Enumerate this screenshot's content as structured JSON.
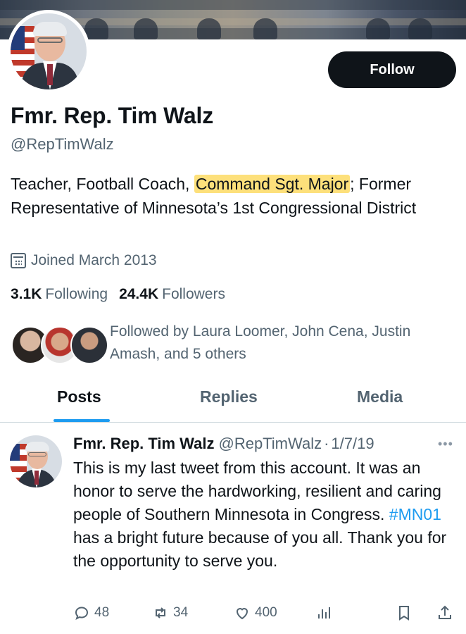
{
  "profile": {
    "follow_label": "Follow",
    "name": "Fmr. Rep. Tim Walz",
    "handle": "@RepTimWalz",
    "bio": {
      "before": "Teacher, Football Coach, ",
      "highlight": "Command Sgt. Major",
      "after": "; Former Representative of Minnesota’s 1st Congressional District"
    },
    "joined": "Joined March 2013",
    "following_count": "3.1K",
    "following_label": "Following",
    "followers_count": "24.4K",
    "followers_label": "Followers",
    "followed_by": "Followed by Laura Loomer, John Cena, Justin Amash, and 5 others"
  },
  "tabs": [
    {
      "label": "Posts",
      "active": true
    },
    {
      "label": "Replies",
      "active": false
    },
    {
      "label": "Media",
      "active": false
    }
  ],
  "tweet": {
    "name": "Fmr. Rep. Tim Walz",
    "handle": "@RepTimWalz",
    "dot": "·",
    "date": "1/7/19",
    "more_icon": "•••",
    "text_before": "This is my last tweet from this account. It was an honor to serve the hardworking, resilient and caring people of Southern Minnesota in Congress. ",
    "hashtag": "#MN01",
    "text_after": " has a bright future because of you all. Thank you for the opportunity to serve you.",
    "replies": "48",
    "retweets": "34",
    "likes": "400"
  },
  "icons": {
    "joined": "calendar-icon",
    "reply": "reply-icon",
    "retweet": "retweet-icon",
    "like": "heart-icon",
    "views": "views-icon",
    "bookmark": "bookmark-icon",
    "share": "share-icon",
    "more": "more-icon"
  },
  "colors": {
    "accent": "#1d9bf0",
    "highlight": "#fde07b",
    "text_primary": "#0f1419",
    "text_secondary": "#536471",
    "button_bg": "#0f1419"
  }
}
